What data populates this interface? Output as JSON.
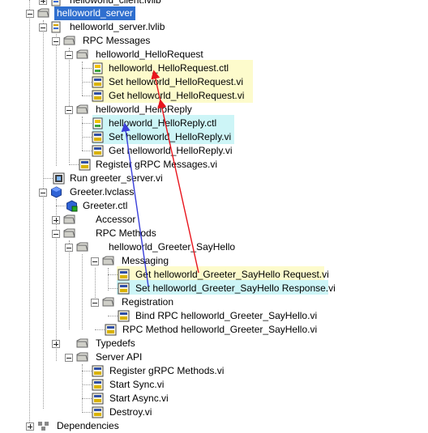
{
  "tree": {
    "items": [
      {
        "label": "helloworld_client.lvlib"
      },
      {
        "label": "helloworld_server"
      },
      {
        "label": "helloworld_server.lvlib"
      },
      {
        "label": "RPC Messages"
      },
      {
        "label": "helloworld_HelloRequest"
      },
      {
        "label": "helloworld_HelloRequest.ctl"
      },
      {
        "label": "Set helloworld_HelloRequest.vi"
      },
      {
        "label": "Get helloworld_HelloRequest.vi"
      },
      {
        "label": "helloworld_HelloReply"
      },
      {
        "label": "helloworld_HelloReply.ctl"
      },
      {
        "label": "Set helloworld_HelloReply.vi"
      },
      {
        "label": "Get helloworld_HelloReply.vi"
      },
      {
        "label": "Register gRPC Messages.vi"
      },
      {
        "label": "Run greeter_server.vi"
      },
      {
        "label": "Greeter.lvclass"
      },
      {
        "label": "Greeter.ctl"
      },
      {
        "label": "Accessor"
      },
      {
        "label": "RPC Methods"
      },
      {
        "label": "helloworld_Greeter_SayHello"
      },
      {
        "label": "Messaging"
      },
      {
        "label": "Get helloworld_Greeter_SayHello Request.vi"
      },
      {
        "label": "Set helloworld_Greeter_SayHello Response.vi"
      },
      {
        "label": "Registration"
      },
      {
        "label": "Bind RPC helloworld_Greeter_SayHello.vi"
      },
      {
        "label": "RPC Method helloworld_Greeter_SayHello.vi"
      },
      {
        "label": "Typedefs"
      },
      {
        "label": "Server API"
      },
      {
        "label": "Register gRPC Methods.vi"
      },
      {
        "label": "Start Sync.vi"
      },
      {
        "label": "Start Async.vi"
      },
      {
        "label": "Destroy.vi"
      },
      {
        "label": "Dependencies"
      }
    ]
  },
  "annotations": {
    "highlight_yellow": "#fdfbcc",
    "highlight_cyan": "#cdf5f7",
    "selection_color": "#2f6fcf",
    "red_arrow_color": "#e8141c",
    "blue_arrow_color": "#3a3fd9"
  }
}
